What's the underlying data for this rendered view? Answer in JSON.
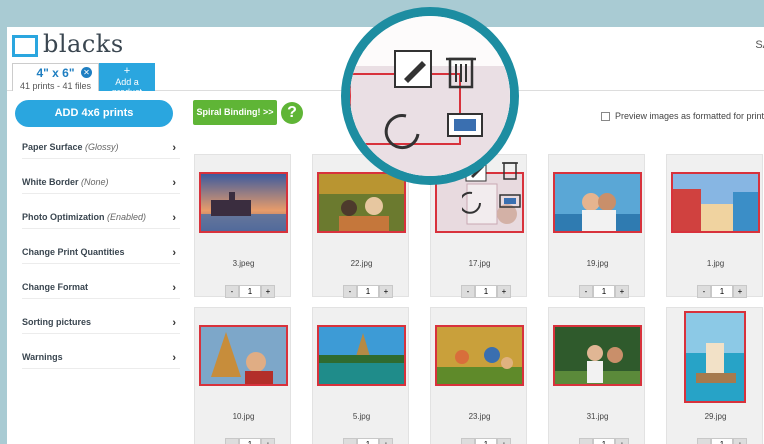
{
  "header": {
    "logo": "blacks",
    "right_text": "SA"
  },
  "tabs": {
    "active": {
      "size": "4\" x 6\"",
      "info": "41 prints - 41 files"
    },
    "add": {
      "plus": "+",
      "label": "Add a product"
    }
  },
  "sidebar": {
    "add_button": "ADD 4x6 prints",
    "items": [
      {
        "label": "Paper Surface",
        "value": "(Glossy)"
      },
      {
        "label": "White Border",
        "value": "(None)"
      },
      {
        "label": "Photo Optimization",
        "value": "(Enabled)"
      },
      {
        "label": "Change Print Quantities",
        "value": ""
      },
      {
        "label": "Change Format",
        "value": ""
      },
      {
        "label": "Sorting pictures",
        "value": ""
      },
      {
        "label": "Warnings",
        "value": ""
      }
    ]
  },
  "toolbar": {
    "spiral_label": "Spiral Binding! >>",
    "help": "?",
    "preview_label": "Preview images as formatted for printing"
  },
  "photos": [
    {
      "name": "3.jpeg",
      "qty": "1"
    },
    {
      "name": "22.jpg",
      "qty": "1"
    },
    {
      "name": "17.jpg",
      "qty": "1"
    },
    {
      "name": "19.jpg",
      "qty": "1"
    },
    {
      "name": "1.jpg",
      "qty": "1"
    },
    {
      "name": "10.jpg",
      "qty": "1"
    },
    {
      "name": "5.jpg",
      "qty": "1"
    },
    {
      "name": "23.jpg",
      "qty": "1"
    },
    {
      "name": "31.jpg",
      "qty": "1"
    },
    {
      "name": "29.jpg",
      "qty": "1"
    }
  ],
  "qty_controls": {
    "minus": "-",
    "plus": "+"
  },
  "icons": [
    "pencil-icon",
    "trash-icon",
    "rotate-icon",
    "crop-icon"
  ],
  "colors": {
    "accent": "#2aa6df",
    "green": "#5fb536",
    "red_border": "#d8323c",
    "magnifier": "#1d8da1"
  }
}
